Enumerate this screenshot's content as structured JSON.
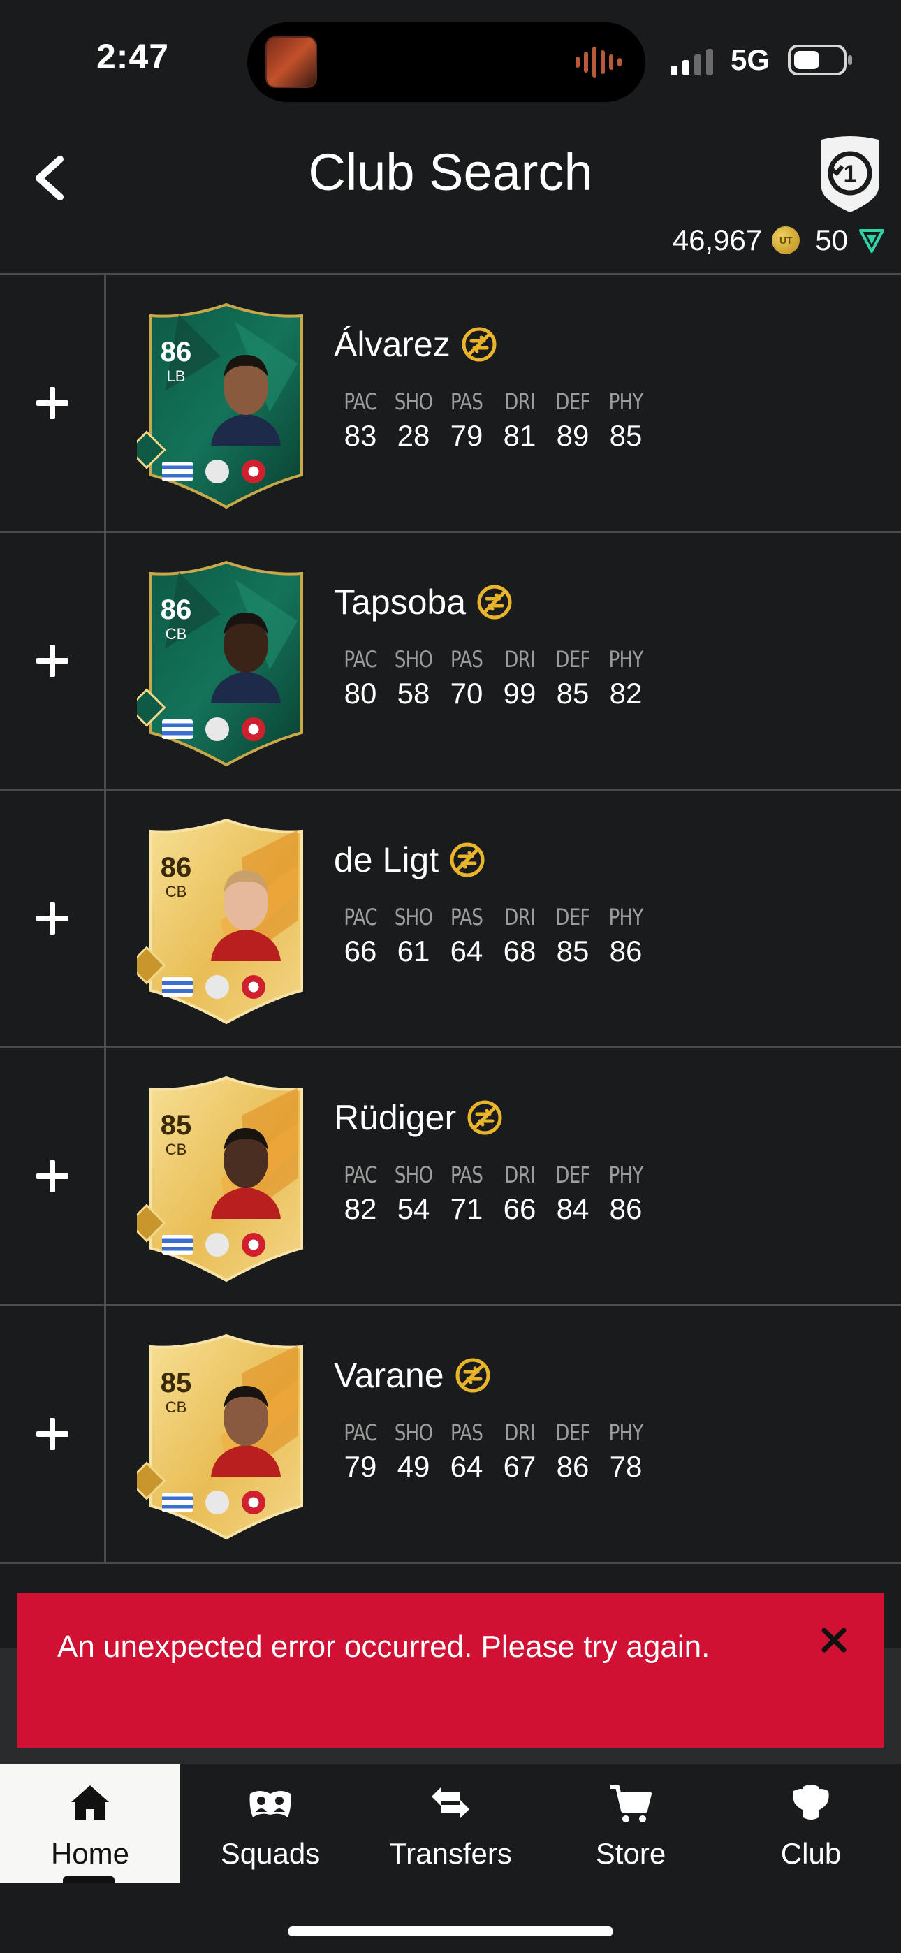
{
  "status_bar": {
    "time": "2:47",
    "network": "5G"
  },
  "header": {
    "title": "Club Search",
    "coins": "46,967",
    "points": "50",
    "coin_symbol": "UT"
  },
  "stat_labels": [
    "PAC",
    "SHO",
    "PAS",
    "DRI",
    "DEF",
    "PHY"
  ],
  "players": [
    {
      "name": "Álvarez",
      "rating": "86",
      "position": "LB",
      "card": "green-special",
      "stats": [
        "83",
        "28",
        "79",
        "81",
        "89",
        "85"
      ]
    },
    {
      "name": "Tapsoba",
      "rating": "86",
      "position": "CB",
      "card": "green-special",
      "stats": [
        "80",
        "58",
        "70",
        "99",
        "85",
        "82"
      ]
    },
    {
      "name": "de Ligt",
      "rating": "86",
      "position": "CB",
      "card": "gold-rare",
      "stats": [
        "66",
        "61",
        "64",
        "68",
        "85",
        "86"
      ]
    },
    {
      "name": "Rüdiger",
      "rating": "85",
      "position": "CB",
      "card": "gold-rare",
      "stats": [
        "82",
        "54",
        "71",
        "66",
        "84",
        "86"
      ]
    },
    {
      "name": "Varane",
      "rating": "85",
      "position": "CB",
      "card": "gold-rare",
      "stats": [
        "79",
        "49",
        "64",
        "67",
        "86",
        "78"
      ]
    }
  ],
  "error": {
    "message": "An unexpected error occurred. Please try again."
  },
  "tabs": [
    {
      "label": "Home",
      "icon": "home-icon",
      "active": true
    },
    {
      "label": "Squads",
      "icon": "squads-icon",
      "active": false
    },
    {
      "label": "Transfers",
      "icon": "transfers-icon",
      "active": false
    },
    {
      "label": "Store",
      "icon": "store-icon",
      "active": false
    },
    {
      "label": "Club",
      "icon": "club-icon",
      "active": false
    }
  ],
  "colors": {
    "background": "#1a1b1c",
    "error": "#d01134",
    "gold": "#e8b42a",
    "active_tab": "#f7f7f5"
  }
}
